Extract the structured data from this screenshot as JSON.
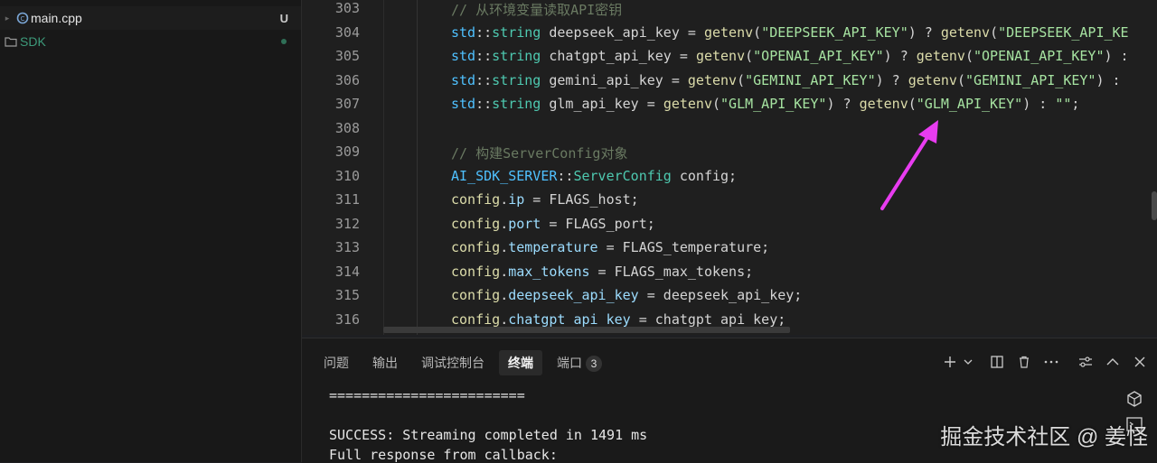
{
  "explorer": {
    "files": [
      {
        "name": "main.cpp",
        "status": "U"
      },
      {
        "name": "SDK"
      }
    ]
  },
  "editor": {
    "line_numbers": [
      "303",
      "304",
      "305",
      "306",
      "307",
      "308",
      "309",
      "310",
      "311",
      "312",
      "313",
      "314",
      "315",
      "316"
    ],
    "lines": [
      [
        {
          "t": "// 从环境变量读取API密钥",
          "c": "com"
        }
      ],
      [
        {
          "t": "std",
          "c": "ns"
        },
        {
          "t": "::",
          "c": "id"
        },
        {
          "t": "string",
          "c": "ty"
        },
        {
          "t": " deepseek_api_key = ",
          "c": "id"
        },
        {
          "t": "getenv",
          "c": "fn"
        },
        {
          "t": "(",
          "c": "id"
        },
        {
          "t": "\"DEEPSEEK_API_KEY\"",
          "c": "str"
        },
        {
          "t": ") ? ",
          "c": "id"
        },
        {
          "t": "getenv",
          "c": "fn"
        },
        {
          "t": "(",
          "c": "id"
        },
        {
          "t": "\"DEEPSEEK_API_KE",
          "c": "str"
        }
      ],
      [
        {
          "t": "std",
          "c": "ns"
        },
        {
          "t": "::",
          "c": "id"
        },
        {
          "t": "string",
          "c": "ty"
        },
        {
          "t": " chatgpt_api_key = ",
          "c": "id"
        },
        {
          "t": "getenv",
          "c": "fn"
        },
        {
          "t": "(",
          "c": "id"
        },
        {
          "t": "\"OPENAI_API_KEY\"",
          "c": "str"
        },
        {
          "t": ") ? ",
          "c": "id"
        },
        {
          "t": "getenv",
          "c": "fn"
        },
        {
          "t": "(",
          "c": "id"
        },
        {
          "t": "\"OPENAI_API_KEY\"",
          "c": "str"
        },
        {
          "t": ") :",
          "c": "id"
        }
      ],
      [
        {
          "t": "std",
          "c": "ns"
        },
        {
          "t": "::",
          "c": "id"
        },
        {
          "t": "string",
          "c": "ty"
        },
        {
          "t": " gemini_api_key = ",
          "c": "id"
        },
        {
          "t": "getenv",
          "c": "fn"
        },
        {
          "t": "(",
          "c": "id"
        },
        {
          "t": "\"GEMINI_API_KEY\"",
          "c": "str"
        },
        {
          "t": ") ? ",
          "c": "id"
        },
        {
          "t": "getenv",
          "c": "fn"
        },
        {
          "t": "(",
          "c": "id"
        },
        {
          "t": "\"GEMINI_API_KEY\"",
          "c": "str"
        },
        {
          "t": ") :",
          "c": "id"
        }
      ],
      [
        {
          "t": "std",
          "c": "ns"
        },
        {
          "t": "::",
          "c": "id"
        },
        {
          "t": "string",
          "c": "ty"
        },
        {
          "t": " glm_api_key = ",
          "c": "id"
        },
        {
          "t": "getenv",
          "c": "fn"
        },
        {
          "t": "(",
          "c": "id"
        },
        {
          "t": "\"GLM_API_KEY\"",
          "c": "str"
        },
        {
          "t": ") ? ",
          "c": "id"
        },
        {
          "t": "getenv",
          "c": "fn"
        },
        {
          "t": "(",
          "c": "id"
        },
        {
          "t": "\"GLM_API_KEY\"",
          "c": "str"
        },
        {
          "t": ") : ",
          "c": "id"
        },
        {
          "t": "\"\"",
          "c": "str"
        },
        {
          "t": ";",
          "c": "id"
        }
      ],
      [],
      [
        {
          "t": "// 构建ServerConfig对象",
          "c": "com"
        }
      ],
      [
        {
          "t": "AI_SDK_SERVER",
          "c": "ns"
        },
        {
          "t": "::",
          "c": "id"
        },
        {
          "t": "ServerConfig",
          "c": "ty"
        },
        {
          "t": " config;",
          "c": "id"
        }
      ],
      [
        {
          "t": "config",
          "c": "fn"
        },
        {
          "t": ".",
          "c": "id"
        },
        {
          "t": "ip",
          "c": "mem"
        },
        {
          "t": " = FLAGS_host;",
          "c": "id"
        }
      ],
      [
        {
          "t": "config",
          "c": "fn"
        },
        {
          "t": ".",
          "c": "id"
        },
        {
          "t": "port",
          "c": "mem"
        },
        {
          "t": " = FLAGS_port;",
          "c": "id"
        }
      ],
      [
        {
          "t": "config",
          "c": "fn"
        },
        {
          "t": ".",
          "c": "id"
        },
        {
          "t": "temperature",
          "c": "mem"
        },
        {
          "t": " = FLAGS_temperature;",
          "c": "id"
        }
      ],
      [
        {
          "t": "config",
          "c": "fn"
        },
        {
          "t": ".",
          "c": "id"
        },
        {
          "t": "max_tokens",
          "c": "mem"
        },
        {
          "t": " = FLAGS_max_tokens;",
          "c": "id"
        }
      ],
      [
        {
          "t": "config",
          "c": "fn"
        },
        {
          "t": ".",
          "c": "id"
        },
        {
          "t": "deepseek_api_key",
          "c": "mem"
        },
        {
          "t": " = deepseek_api_key;",
          "c": "id"
        }
      ],
      [
        {
          "t": "config",
          "c": "fn"
        },
        {
          "t": ".",
          "c": "id"
        },
        {
          "t": "chatgpt_api_key",
          "c": "mem"
        },
        {
          "t": " = chatgpt_api_key;",
          "c": "id"
        }
      ]
    ]
  },
  "panel": {
    "tabs": [
      "问题",
      "输出",
      "调试控制台",
      "终端",
      "端口"
    ],
    "active_tab": "终端",
    "ports_count": "3",
    "actions": [
      "plus-icon",
      "chevron-down-icon",
      "split-icon",
      "trash-icon",
      "more-icon",
      "settings-sliders-icon",
      "chevron-up-icon",
      "close-icon"
    ]
  },
  "terminal": {
    "lines": [
      "========================",
      "",
      "SUCCESS: Streaming completed in 1491 ms",
      "Full response from callback:"
    ]
  },
  "watermark": "掘金技术社区 @ 姜怪",
  "colors": {
    "annotation_arrow": "#e83cf0",
    "string": "#a6e3a1",
    "function": "#dcdcaa",
    "namespace": "#4fc1ff"
  }
}
